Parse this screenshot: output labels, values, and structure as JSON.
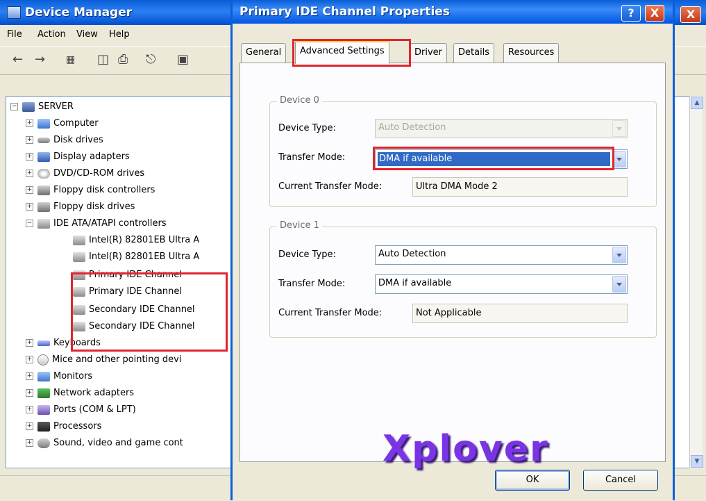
{
  "device_manager": {
    "title": "Device Manager",
    "menu": [
      "File",
      "Action",
      "View",
      "Help"
    ],
    "close_glyph": "X",
    "tree": {
      "root": "SERVER",
      "categories": [
        {
          "label": "Computer",
          "icon": "computer-icon"
        },
        {
          "label": "Disk drives",
          "icon": "disk-icon"
        },
        {
          "label": "Display adapters",
          "icon": "display-adapter-icon"
        },
        {
          "label": "DVD/CD-ROM drives",
          "icon": "dvd-icon"
        },
        {
          "label": "Floppy disk controllers",
          "icon": "floppy-controller-icon"
        },
        {
          "label": "Floppy disk drives",
          "icon": "floppy-drive-icon"
        },
        {
          "label": "IDE ATA/ATAPI controllers",
          "icon": "ide-controller-icon"
        },
        {
          "label": "Keyboards",
          "icon": "keyboard-icon"
        },
        {
          "label": "Mice and other pointing devi",
          "icon": "mouse-icon"
        },
        {
          "label": "Monitors",
          "icon": "monitor-icon"
        },
        {
          "label": "Network adapters",
          "icon": "network-icon"
        },
        {
          "label": "Ports (COM & LPT)",
          "icon": "ports-icon"
        },
        {
          "label": "Processors",
          "icon": "processor-icon"
        },
        {
          "label": "Sound, video and game cont",
          "icon": "sound-icon"
        }
      ],
      "ide_children": [
        "Intel(R) 82801EB Ultra A",
        "Intel(R) 82801EB Ultra A",
        "Primary IDE Channel",
        "Primary IDE Channel",
        "Secondary IDE Channel",
        "Secondary IDE Channel"
      ]
    }
  },
  "dialog": {
    "title": "Primary IDE Channel Properties",
    "help_glyph": "?",
    "close_glyph": "X",
    "tabs": [
      "General",
      "Advanced Settings",
      "Driver",
      "Details",
      "Resources"
    ],
    "selected_tab": "Advanced Settings",
    "device0": {
      "group_title": "Device 0",
      "device_type_label": "Device Type:",
      "device_type_value": "Auto Detection",
      "transfer_mode_label": "Transfer Mode:",
      "transfer_mode_value": "DMA if available",
      "current_mode_label": "Current Transfer Mode:",
      "current_mode_value": "Ultra DMA Mode 2"
    },
    "device1": {
      "group_title": "Device 1",
      "device_type_label": "Device Type:",
      "device_type_value": "Auto Detection",
      "transfer_mode_label": "Transfer Mode:",
      "transfer_mode_value": "DMA if available",
      "current_mode_label": "Current Transfer Mode:",
      "current_mode_value": "Not Applicable"
    },
    "ok_label": "OK",
    "cancel_label": "Cancel"
  },
  "watermark": "Xplover",
  "colors": {
    "titlebar_blue": "#0a5fd8",
    "highlight_red": "#e0252b",
    "selection_blue": "#316ac5",
    "watermark_purple": "#7a34e6"
  }
}
